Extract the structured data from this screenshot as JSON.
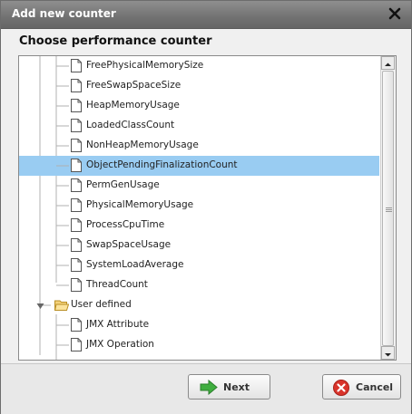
{
  "dialog": {
    "title": "Add new counter",
    "heading": "Choose performance counter"
  },
  "tree": {
    "items": [
      {
        "label": "FreePhysicalMemorySize",
        "type": "leaf",
        "selected": false
      },
      {
        "label": "FreeSwapSpaceSize",
        "type": "leaf",
        "selected": false
      },
      {
        "label": "HeapMemoryUsage",
        "type": "leaf",
        "selected": false
      },
      {
        "label": "LoadedClassCount",
        "type": "leaf",
        "selected": false
      },
      {
        "label": "NonHeapMemoryUsage",
        "type": "leaf",
        "selected": false
      },
      {
        "label": "ObjectPendingFinalizationCount",
        "type": "leaf",
        "selected": true
      },
      {
        "label": "PermGenUsage",
        "type": "leaf",
        "selected": false
      },
      {
        "label": "PhysicalMemoryUsage",
        "type": "leaf",
        "selected": false
      },
      {
        "label": "ProcessCpuTime",
        "type": "leaf",
        "selected": false
      },
      {
        "label": "SwapSpaceUsage",
        "type": "leaf",
        "selected": false
      },
      {
        "label": "SystemLoadAverage",
        "type": "leaf",
        "selected": false
      },
      {
        "label": "ThreadCount",
        "type": "leaf",
        "selected": false
      },
      {
        "label": "User defined",
        "type": "folder",
        "expanded": true,
        "selected": false
      },
      {
        "label": "JMX Attribute",
        "type": "leaf",
        "selected": false
      },
      {
        "label": "JMX Operation",
        "type": "leaf",
        "selected": false
      }
    ]
  },
  "buttons": {
    "next_label": "Next",
    "cancel_label": "Cancel"
  },
  "colors": {
    "selection": "#99ccf2",
    "next_arrow": "#3fae3f",
    "cancel_icon": "#d9342b"
  }
}
